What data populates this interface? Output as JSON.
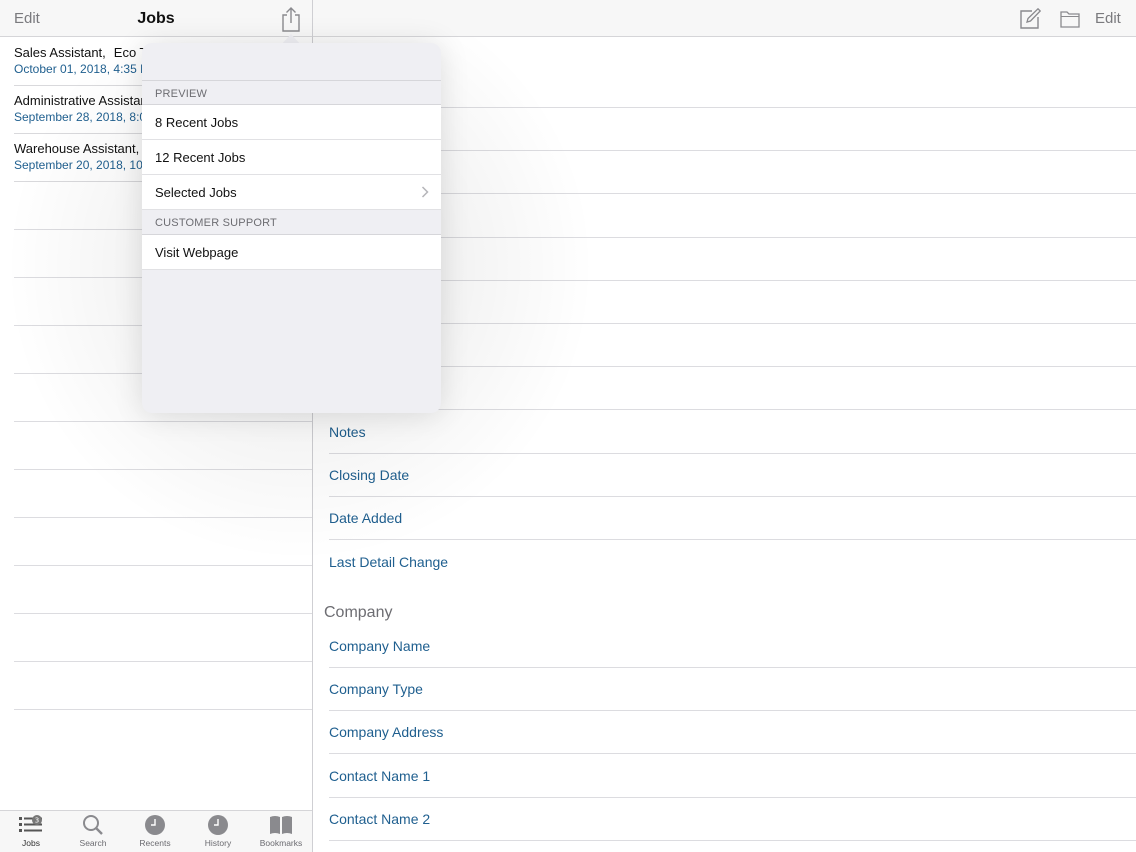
{
  "master": {
    "edit_label": "Edit",
    "title": "Jobs",
    "jobs": [
      {
        "title": "Sales Assistant,",
        "company": "Eco T",
        "date": "October 01, 2018, 4:35 P"
      },
      {
        "title": "Administrative Assistant",
        "company": "",
        "date": "September 28, 2018, 8:0"
      },
      {
        "title": "Warehouse Assistant,",
        "company": "",
        "date": "September 20, 2018, 10"
      }
    ]
  },
  "tabbar": {
    "tabs": [
      {
        "label": "Jobs",
        "badge": "3"
      },
      {
        "label": "Search"
      },
      {
        "label": "Recents"
      },
      {
        "label": "History"
      },
      {
        "label": "Bookmarks"
      }
    ]
  },
  "detail": {
    "edit_label": "Edit",
    "fields_top": [
      "Notes",
      "Closing Date",
      "Date Added",
      "Last Detail Change"
    ],
    "company_section": "Company",
    "company_fields": [
      "Company Name",
      "Company Type",
      "Company Address",
      "Contact Name 1",
      "Contact Name 2"
    ]
  },
  "popover": {
    "preview_header": "PREVIEW",
    "preview_items": [
      "8 Recent Jobs",
      "12 Recent Jobs",
      "Selected Jobs"
    ],
    "support_header": "CUSTOMER SUPPORT",
    "support_items": [
      "Visit Webpage"
    ]
  },
  "colors": {
    "link_blue": "#1f5f8f",
    "nav_gray": "#7a7a7e"
  }
}
